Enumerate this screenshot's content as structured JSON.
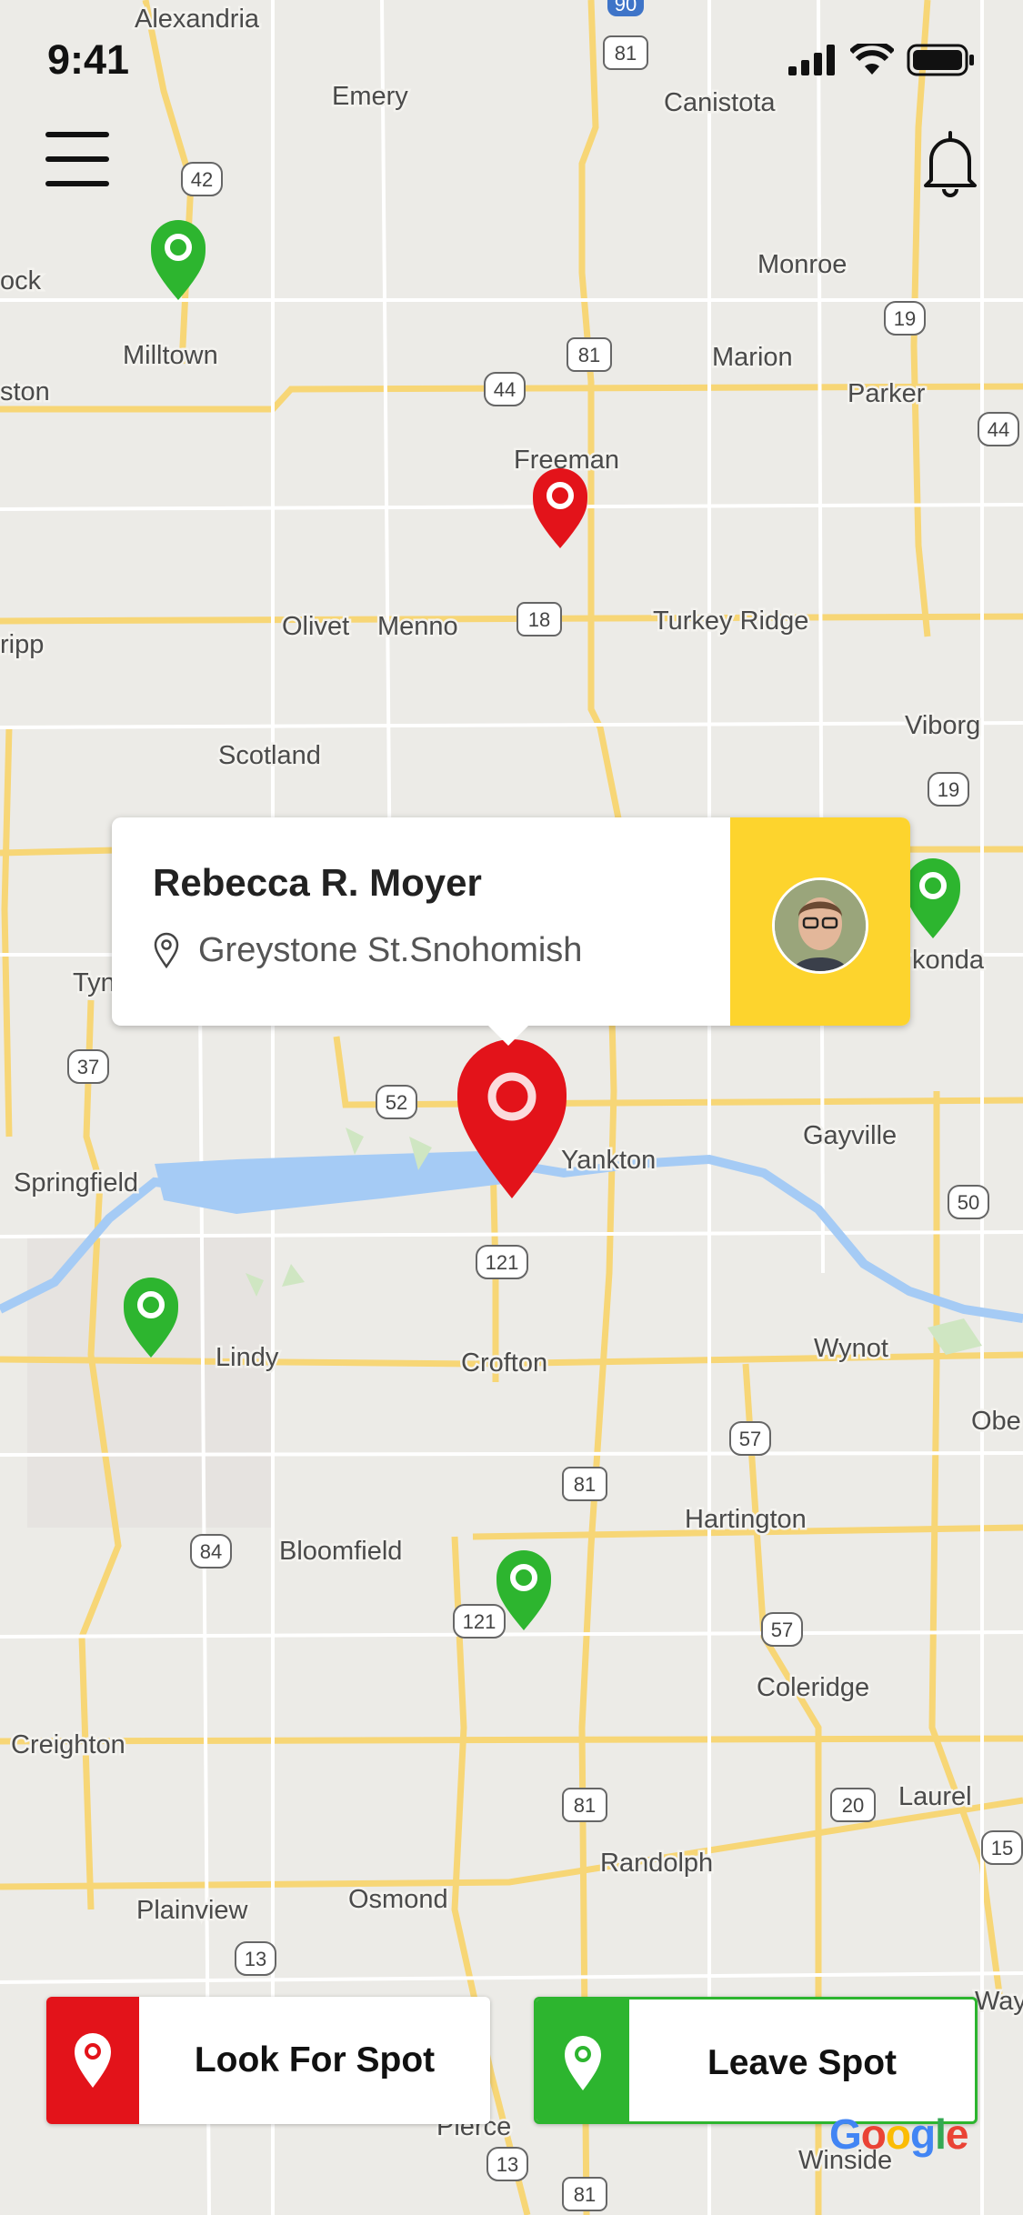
{
  "status_bar": {
    "time": "9:41"
  },
  "map": {
    "places": [
      "Alexandria",
      "Emery",
      "Canistota",
      "Monroe",
      "Milltown",
      "Marion",
      "Parker",
      "Freeman",
      "Olivet",
      "Menno",
      "Turkey Ridge",
      "Scotland",
      "Viborg",
      "Gayville",
      "Yankton",
      "Springfield",
      "Lindy",
      "Crofton",
      "Wynot",
      "Hartington",
      "Bloomfield",
      "Coleridge",
      "Creighton",
      "Laurel",
      "Randolph",
      "Plainview",
      "Osmond",
      "Pierce",
      "Winside",
      "ock",
      "ston",
      "ripp",
      "Tyn",
      "konda",
      "Obe",
      "Way"
    ],
    "shields": [
      "90",
      "81",
      "42",
      "19",
      "81",
      "44",
      "44",
      "18",
      "19",
      "52",
      "50",
      "121",
      "57",
      "81",
      "84",
      "121",
      "57",
      "81",
      "20",
      "13",
      "13",
      "81",
      "37",
      "15"
    ],
    "attribution": "Google"
  },
  "popup": {
    "name": "Rebecca R. Moyer",
    "address": "Greystone St.Snohomish"
  },
  "actions": {
    "look_for_spot": "Look For Spot",
    "leave_spot": "Leave Spot"
  },
  "colors": {
    "red": "#e3131a",
    "green": "#2db52f",
    "yellow": "#fdd42d"
  },
  "icons": [
    "menu-icon",
    "bell-icon",
    "location-pin-icon",
    "signal-icon",
    "wifi-icon",
    "battery-icon"
  ]
}
